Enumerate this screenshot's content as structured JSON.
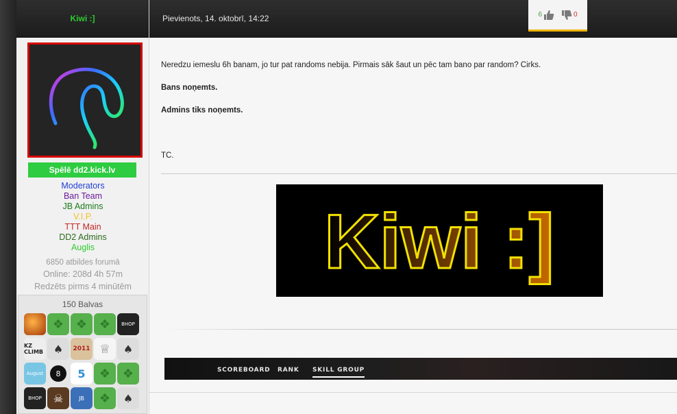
{
  "user": {
    "username": "Kiwi :]",
    "playing": "Spēlē dd2.kick.lv",
    "groups": [
      {
        "label": "Moderators",
        "color": "#1f3fd6"
      },
      {
        "label": "Ban Team",
        "color": "#6a1b9a"
      },
      {
        "label": "JB Admins",
        "color": "#1b7a1b"
      },
      {
        "label": "V.I.P.",
        "color": "#f0c020"
      },
      {
        "label": "TTT Main",
        "color": "#c62828"
      },
      {
        "label": "DD2 Admins",
        "color": "#2e6b1e"
      },
      {
        "label": "Auglis",
        "color": "#2ecc2e"
      }
    ],
    "stats": {
      "posts": "6850 atbildes forumā",
      "online": "Online: 208d 4h 57m",
      "seen": "Redzēts pirms 4 minūtēm"
    },
    "awards_title": "150 Balvas",
    "awards": [
      {
        "type": "fire",
        "label": ""
      },
      {
        "type": "puzzle",
        "label": ""
      },
      {
        "type": "puzzle",
        "label": ""
      },
      {
        "type": "puzzle",
        "label": ""
      },
      {
        "type": "bhop",
        "label": "BHOP"
      },
      {
        "type": "kz",
        "label": "KZ CLIMB"
      },
      {
        "type": "cards",
        "label": ""
      },
      {
        "type": "year",
        "label": "2011"
      },
      {
        "type": "trophy",
        "label": ""
      },
      {
        "type": "cards",
        "label": ""
      },
      {
        "type": "august",
        "label": "August"
      },
      {
        "type": "eight",
        "label": ""
      },
      {
        "type": "five",
        "label": "5"
      },
      {
        "type": "puzzle",
        "label": ""
      },
      {
        "type": "puzzle",
        "label": ""
      },
      {
        "type": "bhop",
        "label": "BHOP"
      },
      {
        "type": "pirate",
        "label": ""
      },
      {
        "type": "jb",
        "label": "JB"
      },
      {
        "type": "puzzle",
        "label": ""
      },
      {
        "type": "cards",
        "label": ""
      }
    ]
  },
  "post": {
    "date": "Pievienots, 14. oktobrī, 14:22",
    "likes": "6",
    "dislikes": "0",
    "line1": "Neredzu iemeslu 6h banam, jo tur pat randoms nebija. Pirmais sāk šaut un pēc tam bano par random? Cirks.",
    "line2": "Bans noņemts.",
    "line3": "Admins tiks noņemts.",
    "line4": "TC.",
    "signature_text": "Kiwi :]"
  },
  "banner": {
    "tabs": [
      "SCOREBOARD",
      "RANK",
      "SKILL GROUP"
    ],
    "active_tab": "SKILL GROUP"
  },
  "colors": {
    "accent_yellow": "#f0b400",
    "avatar_border": "#d60000",
    "playing_bg": "#2ecc40"
  }
}
